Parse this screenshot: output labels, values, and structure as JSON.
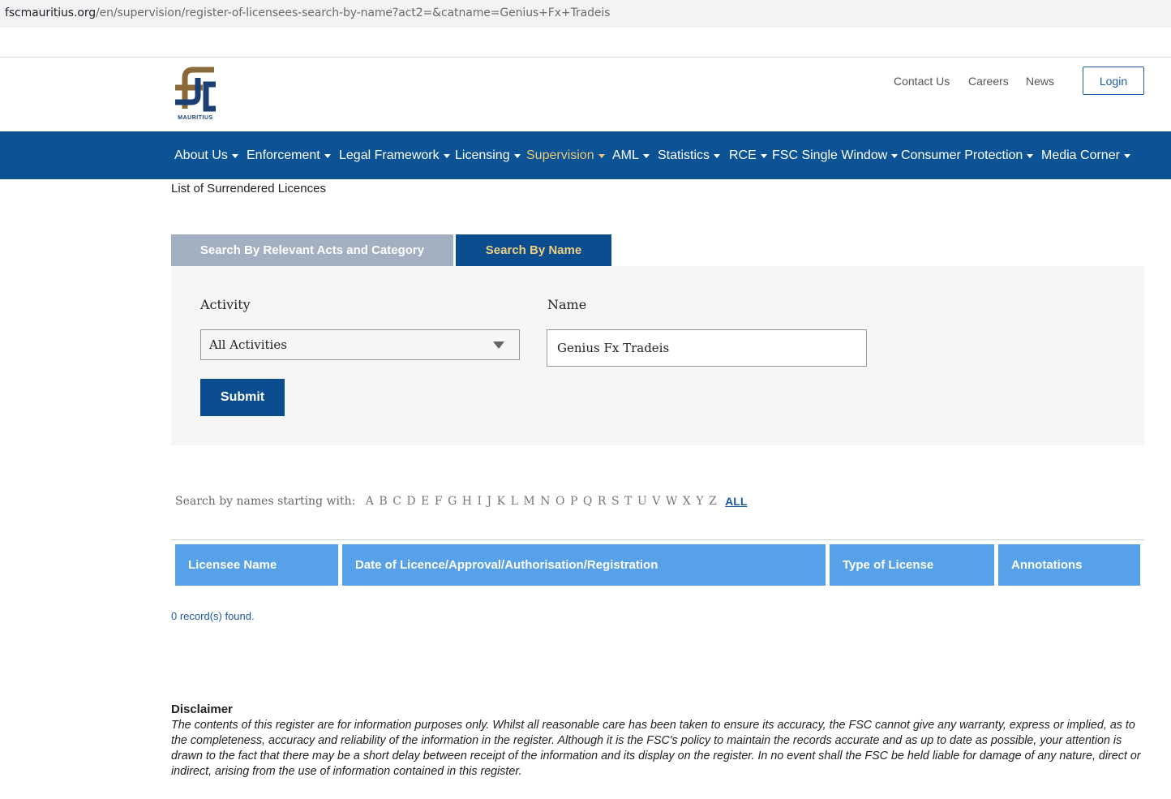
{
  "browser": {
    "url_host": "fscmauritius.org",
    "url_path": "/en/supervision/register-of-licensees-search-by-name?act2=&catname=Genius+Fx+Tradeis"
  },
  "header": {
    "logo_text": "MAURITIUS",
    "utility_links": [
      "Contact Us",
      "Careers",
      "News"
    ],
    "login_label": "Login"
  },
  "nav": {
    "items": [
      "About Us",
      "Enforcement",
      "Legal Framework",
      "Licensing",
      "Supervision",
      "AML",
      "Statistics",
      "RCE",
      "FSC Single Window",
      "Consumer Protection",
      "Media Corner"
    ],
    "active": "Supervision"
  },
  "breadcrumb_line": "List of Surrendered Licences",
  "tabs": {
    "acts_label": "Search By Relevant Acts and Category",
    "name_label": "Search By Name"
  },
  "form": {
    "activity_label": "Activity",
    "activity_value": "All Activities",
    "name_label": "Name",
    "name_value": "Genius Fx Tradeis",
    "submit_label": "Submit"
  },
  "alpha": {
    "prefix": "Search by names starting with:",
    "letters": [
      "A",
      "B",
      "C",
      "D",
      "E",
      "F",
      "G",
      "H",
      "I",
      "J",
      "K",
      "L",
      "M",
      "N",
      "O",
      "P",
      "Q",
      "R",
      "S",
      "T",
      "U",
      "V",
      "W",
      "X",
      "Y",
      "Z"
    ],
    "all_label": "ALL"
  },
  "table": {
    "headers": [
      "Licensee Name",
      "Date of Licence/Approval/Authorisation/Registration",
      "Type of License",
      "Annotations"
    ]
  },
  "records_text": "0 record(s) found.",
  "disclaimer": {
    "title": "Disclaimer",
    "body": "The contents of this register are for information purposes only. Whilst all reasonable care has been taken to ensure its accuracy, the FSC cannot give any warranty, express or implied, as to the completeness, accuracy and reliability of the information in the register. Although it is the FSC's policy to maintain the records accurate and as up to date as possible, your attention is drawn to the fact that there may be a short delay between receipt of the information and its display on the register. In no event shall the FSC be held liable for damage of any nature, direct or indirect, arising from the use of information contained in this register."
  },
  "colors": {
    "nav_bg": "#0b5394",
    "nav_active": "#e9c87a",
    "tab_inactive": "#a3b0c1",
    "tab_active": "#0b4d8e",
    "table_header": "#56a1e8",
    "logo_gold": "#8a6a3b",
    "logo_blue": "#1b3f73"
  }
}
